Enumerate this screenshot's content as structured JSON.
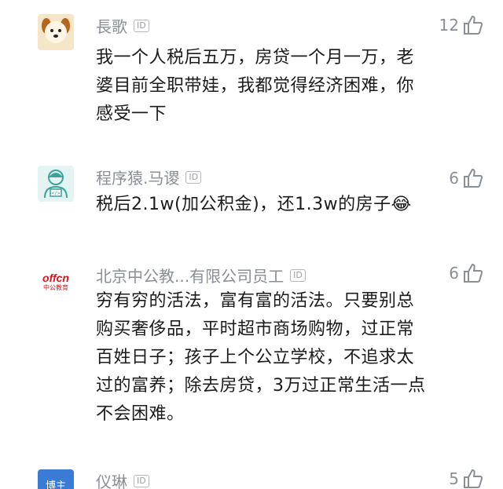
{
  "comments": [
    {
      "avatar_icon": "dog-face-icon",
      "user_name": "長歌",
      "id_badge": "ID",
      "text": "我一个人税后五万，房贷一个月一万，老婆目前全职带娃，我都觉得经济困难，你感受一下",
      "likes": "12"
    },
    {
      "avatar_icon": "programmer-avatar-icon",
      "user_name": "程序猿.马谡",
      "id_badge": "ID",
      "text": "税后2.1w(加公积金)，还1.3w的房子😂",
      "likes": "6"
    },
    {
      "avatar_icon": "offcn-logo-icon",
      "avatar_text_top": "offcn",
      "avatar_text_bottom": "中公教育",
      "user_name": "北京中公教...有限公司员工",
      "id_badge": "ID",
      "text": "穷有穷的活法，富有富的活法。只要别总购买奢侈品，平时超市商场购物，过正常百姓日子；孩子上个公立学校，不追求太过的富养；除去房贷，3万过正常生活一点不会困难。",
      "likes": "6"
    },
    {
      "avatar_icon": "blue-avatar-icon",
      "avatar_text": "博主",
      "user_name": "仪琳",
      "id_badge": "ID",
      "likes": "5"
    }
  ],
  "colors": {
    "meta_gray": "#8a8f96",
    "offcn_red": "#d7141a",
    "avatar_blue": "#3a7bd5"
  }
}
